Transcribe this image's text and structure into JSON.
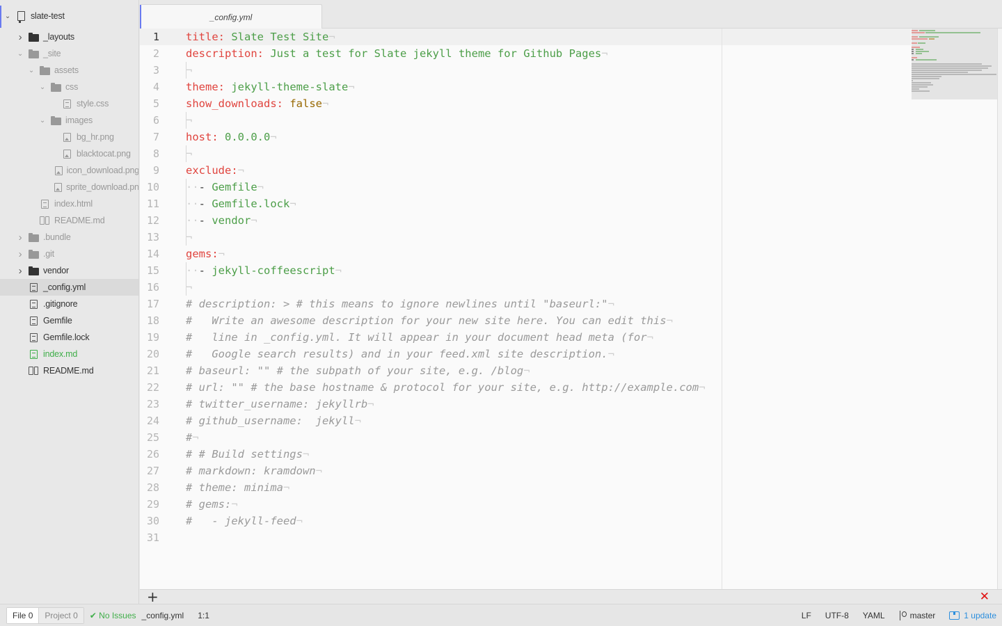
{
  "sidebar": {
    "project": "slate-test",
    "items": [
      {
        "label": "_layouts",
        "type": "folder",
        "expanded": false,
        "depth": 1,
        "dim": false
      },
      {
        "label": "_site",
        "type": "folder",
        "expanded": true,
        "depth": 1,
        "dim": true
      },
      {
        "label": "assets",
        "type": "folder",
        "expanded": true,
        "depth": 2,
        "dim": true
      },
      {
        "label": "css",
        "type": "folder",
        "expanded": true,
        "depth": 3,
        "dim": true
      },
      {
        "label": "style.css",
        "type": "file",
        "depth": 4,
        "dim": true
      },
      {
        "label": "images",
        "type": "folder",
        "expanded": true,
        "depth": 3,
        "dim": true
      },
      {
        "label": "bg_hr.png",
        "type": "image",
        "depth": 4,
        "dim": true
      },
      {
        "label": "blacktocat.png",
        "type": "image",
        "depth": 4,
        "dim": true
      },
      {
        "label": "icon_download.png",
        "type": "image",
        "depth": 4,
        "dim": true
      },
      {
        "label": "sprite_download.png",
        "type": "image",
        "depth": 4,
        "dim": true
      },
      {
        "label": "index.html",
        "type": "file",
        "depth": 2,
        "dim": true
      },
      {
        "label": "README.md",
        "type": "book",
        "depth": 2,
        "dim": true
      },
      {
        "label": ".bundle",
        "type": "folder",
        "expanded": false,
        "depth": 1,
        "dim": true
      },
      {
        "label": ".git",
        "type": "folder",
        "expanded": false,
        "depth": 1,
        "dim": true
      },
      {
        "label": "vendor",
        "type": "folder",
        "expanded": false,
        "depth": 1,
        "dim": false
      },
      {
        "label": "_config.yml",
        "type": "file",
        "depth": 1,
        "selected": true
      },
      {
        "label": ".gitignore",
        "type": "file",
        "depth": 1
      },
      {
        "label": "Gemfile",
        "type": "file",
        "depth": 1
      },
      {
        "label": "Gemfile.lock",
        "type": "file",
        "depth": 1
      },
      {
        "label": "index.md",
        "type": "file",
        "depth": 1,
        "green": true
      },
      {
        "label": "README.md",
        "type": "book",
        "depth": 1
      }
    ]
  },
  "tabs": [
    {
      "label": "_config.yml",
      "active": true
    }
  ],
  "editor": {
    "lines": [
      [
        [
          "k",
          "title:"
        ],
        [
          "t",
          " "
        ],
        [
          "s",
          "Slate Test Site"
        ]
      ],
      [
        [
          "k",
          "description:"
        ],
        [
          "t",
          " "
        ],
        [
          "s",
          "Just a test for Slate jekyll theme for Github Pages"
        ]
      ],
      [],
      [
        [
          "k",
          "theme:"
        ],
        [
          "t",
          " "
        ],
        [
          "s",
          "jekyll-theme-slate"
        ]
      ],
      [
        [
          "k",
          "show_downloads:"
        ],
        [
          "t",
          " "
        ],
        [
          "b",
          "false"
        ]
      ],
      [],
      [
        [
          "k",
          "host:"
        ],
        [
          "t",
          " "
        ],
        [
          "s",
          "0.0.0.0"
        ]
      ],
      [],
      [
        [
          "k",
          "exclude:"
        ]
      ],
      [
        [
          "ind",
          "··"
        ],
        [
          "t",
          "- "
        ],
        [
          "s",
          "Gemfile"
        ]
      ],
      [
        [
          "ind",
          "··"
        ],
        [
          "t",
          "- "
        ],
        [
          "s",
          "Gemfile.lock"
        ]
      ],
      [
        [
          "ind",
          "··"
        ],
        [
          "t",
          "- "
        ],
        [
          "s",
          "vendor"
        ]
      ],
      [],
      [
        [
          "k",
          "gems:"
        ]
      ],
      [
        [
          "ind",
          "··"
        ],
        [
          "t",
          "- "
        ],
        [
          "s",
          "jekyll-coffeescript"
        ]
      ],
      [],
      [
        [
          "c",
          "# description: > # this means to ignore newlines until \"baseurl:\""
        ]
      ],
      [
        [
          "c",
          "#   Write an awesome description for your new site here. You can edit this"
        ]
      ],
      [
        [
          "c",
          "#   line in _config.yml. It will appear in your document head meta (for"
        ]
      ],
      [
        [
          "c",
          "#   Google search results) and in your feed.xml site description."
        ]
      ],
      [
        [
          "c",
          "# baseurl: \"\" # the subpath of your site, e.g. /blog"
        ]
      ],
      [
        [
          "c",
          "# url: \"\" # the base hostname & protocol for your site, e.g. http://example.com"
        ]
      ],
      [
        [
          "c",
          "# twitter_username: jekyllrb"
        ]
      ],
      [
        [
          "c",
          "# github_username:  jekyll"
        ]
      ],
      [
        [
          "c",
          "#"
        ]
      ],
      [
        [
          "c",
          "# # Build settings"
        ]
      ],
      [
        [
          "c",
          "# markdown: kramdown"
        ]
      ],
      [
        [
          "c",
          "# theme: minima"
        ]
      ],
      [
        [
          "c",
          "# gems:"
        ]
      ],
      [
        [
          "c",
          "#   - jekyll-feed"
        ]
      ],
      null
    ],
    "eol_char": "¬"
  },
  "panel": {
    "add": "+",
    "close": "✕"
  },
  "status": {
    "file_tab": "File",
    "file_count": "0",
    "project_tab": "Project",
    "project_count": "0",
    "issues": "✔ No Issues",
    "filename": "_config.yml",
    "cursor": "1:1",
    "line_ending": "LF",
    "encoding": "UTF-8",
    "grammar": "YAML",
    "branch": "master",
    "updates": "1 update"
  },
  "colors": {
    "accent": "#6a7bf0",
    "keyword": "#e0443e",
    "string": "#4c9e48",
    "comment": "#9a9a9a",
    "ok": "#3fae49",
    "link": "#2d8fdd",
    "error": "#e01010"
  }
}
